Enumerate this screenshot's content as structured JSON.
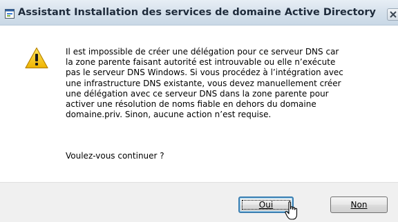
{
  "window": {
    "title": "Assistant Installation des services de domaine Active Directory",
    "close_icon": "close-x-icon",
    "title_icon": "wizard-app-icon"
  },
  "dialog": {
    "icon": "warning-triangle-icon",
    "message_lines": [
      "Il est impossible de créer une délégation pour ce serveur DNS car",
      "la zone parente faisant autorité est introuvable ou elle n’exécute",
      "pas le serveur DNS Windows. Si vous procédez à l’intégration avec",
      "une infrastructure DNS existante, vous devez manuellement créer",
      "une délégation avec ce serveur DNS dans la zone parente pour",
      "activer une résolution de noms fiable en dehors du domaine",
      "domaine.priv. Sinon, aucune action n’est requise."
    ],
    "question": "Voulez-vous continuer ?"
  },
  "buttons": {
    "yes_label": "Oui",
    "no_label": "Non"
  },
  "colors": {
    "titlebar": "#d4e0eb",
    "footer": "#f0f0f0",
    "default_button_border": "#3c7fb1",
    "warning_yellow": "#f2c400"
  }
}
